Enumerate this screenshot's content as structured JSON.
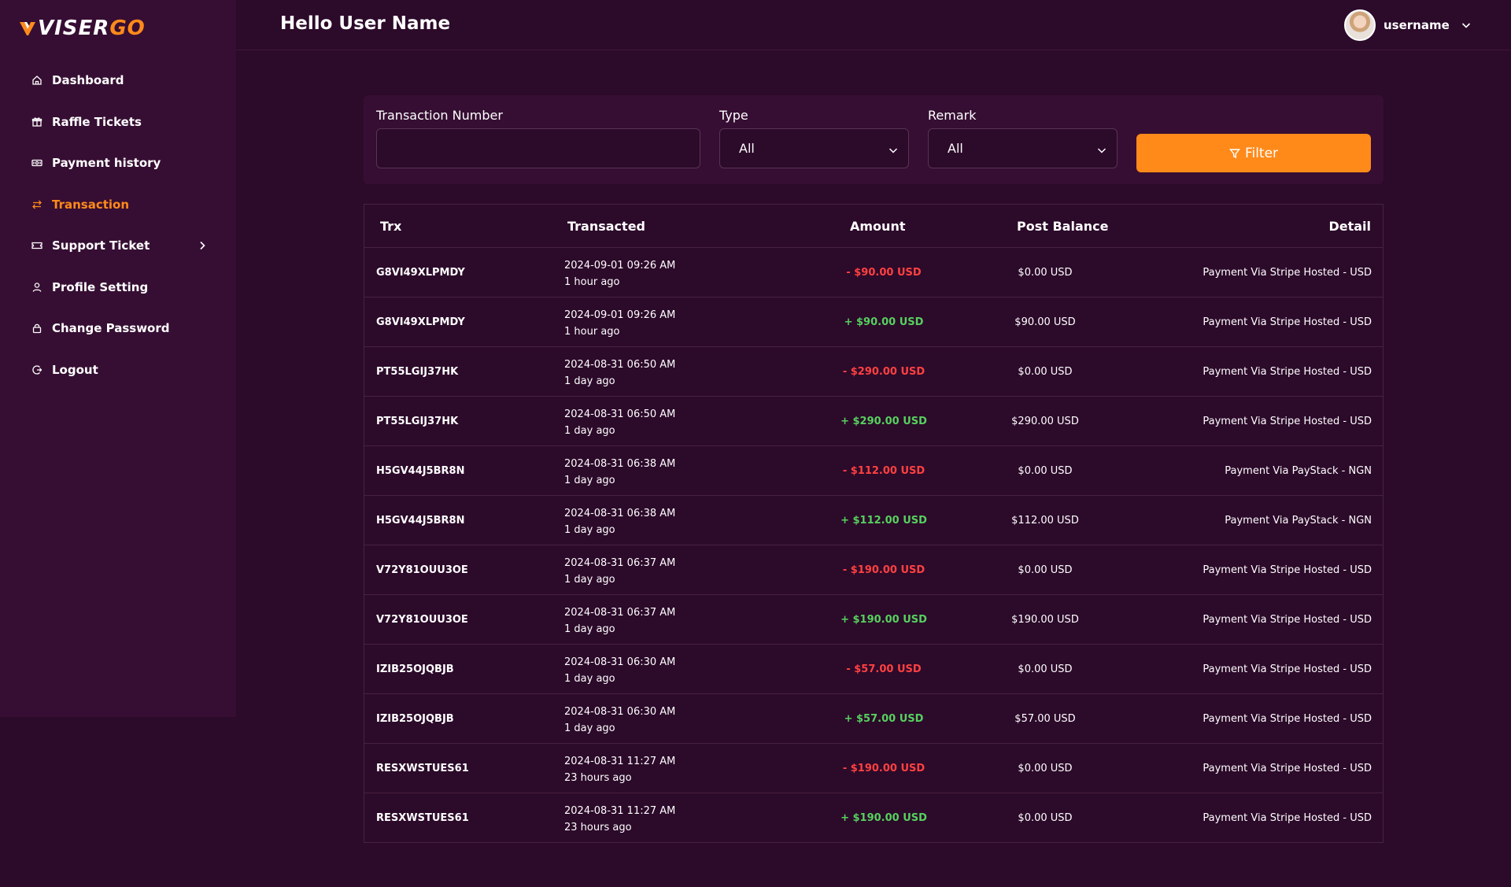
{
  "brand": {
    "part1": "VISER",
    "part2": "GO"
  },
  "colors": {
    "accent": "#ff8a1a",
    "negative": "#ff4141",
    "positive": "#56d15e",
    "bg": "#2c0a2a",
    "panel": "#360e33"
  },
  "sidebar": {
    "items": [
      {
        "label": "Dashboard",
        "icon": "home-icon"
      },
      {
        "label": "Raffle Tickets",
        "icon": "gift-icon"
      },
      {
        "label": "Payment history",
        "icon": "money-icon"
      },
      {
        "label": "Transaction",
        "icon": "exchange-icon",
        "active": true
      },
      {
        "label": "Support Ticket",
        "icon": "ticket-icon",
        "has_submenu": true
      },
      {
        "label": "Profile Setting",
        "icon": "user-icon"
      },
      {
        "label": "Change Password",
        "icon": "lock-icon"
      },
      {
        "label": "Logout",
        "icon": "logout-icon"
      }
    ]
  },
  "header": {
    "greeting": "Hello User Name",
    "username": "username"
  },
  "filters": {
    "trx_label": "Transaction Number",
    "trx_value": "",
    "type_label": "Type",
    "type_value": "All",
    "remark_label": "Remark",
    "remark_value": "All",
    "button_label": "Filter"
  },
  "table": {
    "headers": {
      "trx": "Trx",
      "transacted": "Transacted",
      "amount": "Amount",
      "post_balance": "Post Balance",
      "detail": "Detail"
    },
    "rows": [
      {
        "trx": "G8VI49XLPMDY",
        "date": "2024-09-01 09:26 AM",
        "ago": "1 hour ago",
        "amount": "- $90.00 USD",
        "sign": "neg",
        "balance": "$0.00 USD",
        "detail": "Payment Via Stripe Hosted - USD"
      },
      {
        "trx": "G8VI49XLPMDY",
        "date": "2024-09-01 09:26 AM",
        "ago": "1 hour ago",
        "amount": "+ $90.00 USD",
        "sign": "pos",
        "balance": "$90.00 USD",
        "detail": "Payment Via Stripe Hosted - USD"
      },
      {
        "trx": "PT55LGIJ37HK",
        "date": "2024-08-31 06:50 AM",
        "ago": "1 day ago",
        "amount": "- $290.00 USD",
        "sign": "neg",
        "balance": "$0.00 USD",
        "detail": "Payment Via Stripe Hosted - USD"
      },
      {
        "trx": "PT55LGIJ37HK",
        "date": "2024-08-31 06:50 AM",
        "ago": "1 day ago",
        "amount": "+ $290.00 USD",
        "sign": "pos",
        "balance": "$290.00 USD",
        "detail": "Payment Via Stripe Hosted - USD"
      },
      {
        "trx": "H5GV44J5BR8N",
        "date": "2024-08-31 06:38 AM",
        "ago": "1 day ago",
        "amount": "- $112.00 USD",
        "sign": "neg",
        "balance": "$0.00 USD",
        "detail": "Payment Via PayStack - NGN"
      },
      {
        "trx": "H5GV44J5BR8N",
        "date": "2024-08-31 06:38 AM",
        "ago": "1 day ago",
        "amount": "+ $112.00 USD",
        "sign": "pos",
        "balance": "$112.00 USD",
        "detail": "Payment Via PayStack - NGN"
      },
      {
        "trx": "V72Y81OUU3OE",
        "date": "2024-08-31 06:37 AM",
        "ago": "1 day ago",
        "amount": "- $190.00 USD",
        "sign": "neg",
        "balance": "$0.00 USD",
        "detail": "Payment Via Stripe Hosted - USD"
      },
      {
        "trx": "V72Y81OUU3OE",
        "date": "2024-08-31 06:37 AM",
        "ago": "1 day ago",
        "amount": "+ $190.00 USD",
        "sign": "pos",
        "balance": "$190.00 USD",
        "detail": "Payment Via Stripe Hosted - USD"
      },
      {
        "trx": "IZIB25OJQBJB",
        "date": "2024-08-31 06:30 AM",
        "ago": "1 day ago",
        "amount": "- $57.00 USD",
        "sign": "neg",
        "balance": "$0.00 USD",
        "detail": "Payment Via Stripe Hosted - USD"
      },
      {
        "trx": "IZIB25OJQBJB",
        "date": "2024-08-31 06:30 AM",
        "ago": "1 day ago",
        "amount": "+ $57.00 USD",
        "sign": "pos",
        "balance": "$57.00 USD",
        "detail": "Payment Via Stripe Hosted - USD"
      },
      {
        "trx": "RESXWSTUES61",
        "date": "2024-08-31 11:27 AM",
        "ago": "23 hours ago",
        "amount": "- $190.00 USD",
        "sign": "neg",
        "balance": "$0.00 USD",
        "detail": "Payment Via Stripe Hosted - USD"
      },
      {
        "trx": "RESXWSTUES61",
        "date": "2024-08-31 11:27 AM",
        "ago": "23 hours ago",
        "amount": "+ $190.00 USD",
        "sign": "pos",
        "balance": "$0.00 USD",
        "detail": "Payment Via Stripe Hosted - USD"
      }
    ]
  }
}
